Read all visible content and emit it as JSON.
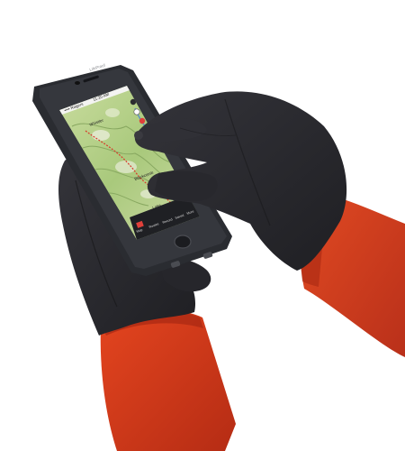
{
  "image": {
    "subject": "gloved-hands-using-smartphone",
    "colors": {
      "background": "#ffffff",
      "glove": "#2b2b2f",
      "glove_shadow": "#1d1d20",
      "jacket": "#d83a1c",
      "jacket_dark": "#a82812",
      "phone_case": "#2a2c31",
      "map_green": "#b9d48b",
      "tab_bar": "#1f2024",
      "tab_active": "#e0403a"
    },
    "icons": [
      "menu-icon",
      "search-icon",
      "record-icon",
      "pin-icon",
      "layers-icon",
      "more-icon",
      "home-button-icon"
    ]
  },
  "phone": {
    "brand_text": "LifeProof",
    "status_carrier": "•••• Rogers",
    "status_time": "11:20 AM",
    "map_labels": [
      "Whistler",
      "Blackcomb",
      "Lake"
    ],
    "tabs": [
      "Map",
      "Routes",
      "Record",
      "Saved",
      "More"
    ]
  }
}
